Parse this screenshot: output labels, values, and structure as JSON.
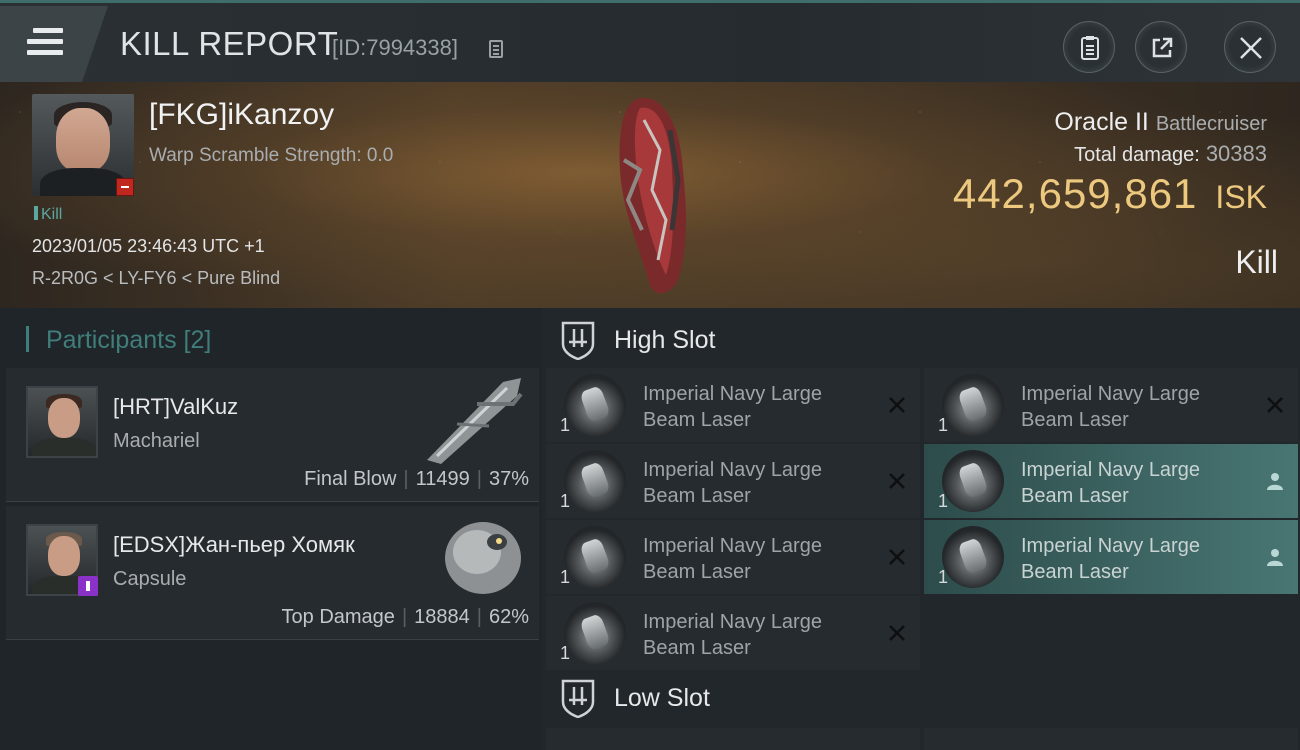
{
  "header": {
    "title": "KILL REPORT",
    "report_id": "[ID:7994338]"
  },
  "victim": {
    "name": "[FKG]iKanzoy",
    "warp_scramble": "Warp Scramble Strength: 0.0",
    "kill_tag": "Kill",
    "datetime": "2023/01/05 23:46:43 UTC +1",
    "location": "R-2R0G < LY-FY6 < Pure Blind",
    "ship_name": "Oracle II",
    "ship_class": "Battlecruiser",
    "total_damage_label": "Total damage:",
    "total_damage_value": "30383",
    "isk_value": "442,659,861",
    "isk_unit": "ISK",
    "outcome": "Kill"
  },
  "participants": {
    "heading": "Participants",
    "count": "[2]",
    "items": [
      {
        "name": "[HRT]ValKuz",
        "ship": "Machariel",
        "role": "Final Blow",
        "damage": "11499",
        "percent": "37%"
      },
      {
        "name": "[EDSX]Жан-пьер Хомяк",
        "ship": "Capsule",
        "role": "Top Damage",
        "damage": "18884",
        "percent": "62%"
      }
    ]
  },
  "fitting": {
    "high_slot_label": "High Slot",
    "low_slot_label": "Low Slot",
    "high_slot": [
      {
        "line1": "Imperial Navy Large",
        "line2": "Beam Laser",
        "qty": "1",
        "state": "destroyed"
      },
      {
        "line1": "Imperial Navy Large",
        "line2": "Beam Laser",
        "qty": "1",
        "state": "destroyed"
      },
      {
        "line1": "Imperial Navy Large",
        "line2": "Beam Laser",
        "qty": "1",
        "state": "destroyed"
      },
      {
        "line1": "Imperial Navy Large",
        "line2": "Beam Laser",
        "qty": "1",
        "state": "destroyed"
      },
      {
        "line1": "Imperial Navy Large",
        "line2": "Beam Laser",
        "qty": "1",
        "state": "dropped"
      },
      {
        "line1": "Imperial Navy Large",
        "line2": "Beam Laser",
        "qty": "1",
        "state": "dropped"
      },
      {
        "line1": "Imperial Navy Large",
        "line2": "Beam Laser",
        "qty": "1",
        "state": "destroyed"
      }
    ]
  },
  "colors": {
    "accent_teal": "#3f7e7a",
    "isk_gold": "#ecc97e",
    "dropped_bg": "#487673",
    "minus_badge": "#c0281f",
    "info_badge": "#8a32c8"
  },
  "icons": [
    "menu-icon",
    "copy-icon",
    "clipboard-icon",
    "share-icon",
    "close-icon",
    "high-slot-icon",
    "low-slot-icon",
    "destroyed-x-icon",
    "dropped-person-icon"
  ]
}
